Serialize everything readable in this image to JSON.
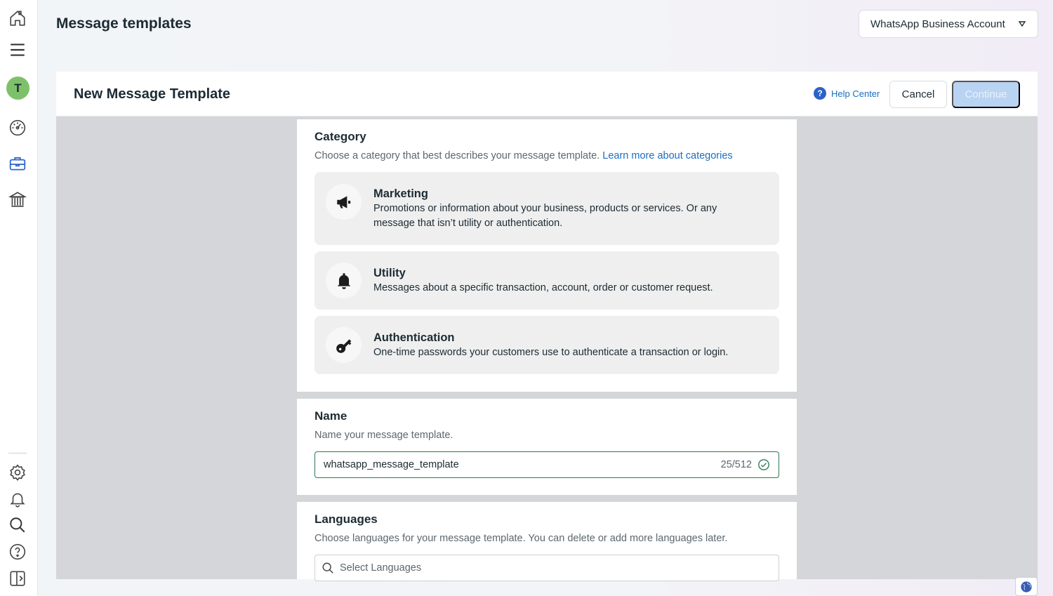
{
  "header": {
    "title": "Message templates",
    "account_select": "WhatsApp Business Account"
  },
  "rail": {
    "avatar_letter": "T",
    "items": [
      {
        "icon": "home-icon"
      },
      {
        "icon": "menu-icon"
      },
      {
        "icon": "dashboard-icon"
      },
      {
        "icon": "briefcase-icon"
      },
      {
        "icon": "bank-icon"
      },
      {
        "icon": "gear-icon"
      },
      {
        "icon": "bell-icon"
      },
      {
        "icon": "search-icon"
      },
      {
        "icon": "help-icon"
      },
      {
        "icon": "sidebar-toggle-icon"
      }
    ]
  },
  "panel": {
    "title": "New Message Template",
    "help_label": "Help Center",
    "cancel_label": "Cancel",
    "continue_label": "Continue"
  },
  "category": {
    "title": "Category",
    "description": "Choose a category that best describes your message template.",
    "learn_more": "Learn more about categories",
    "options": [
      {
        "title": "Marketing",
        "description": "Promotions or information about your business, products or services. Or any message that isn’t utility or authentication.",
        "icon": "megaphone-icon"
      },
      {
        "title": "Utility",
        "description": "Messages about a specific transaction, account, order or customer request.",
        "icon": "bell-icon"
      },
      {
        "title": "Authentication",
        "description": "One-time passwords your customers use to authenticate a transaction or login.",
        "icon": "key-icon"
      }
    ]
  },
  "name": {
    "title": "Name",
    "description": "Name your message template.",
    "value": "whatsapp_message_template",
    "count": "25/512"
  },
  "languages": {
    "title": "Languages",
    "description": "Choose languages for your message template. You can delete or add more languages later.",
    "placeholder": "Select Languages"
  },
  "colors": {
    "accent": "#1a6ec2",
    "valid": "#2d7a56",
    "continue_disabled": "#b9d3f2"
  }
}
